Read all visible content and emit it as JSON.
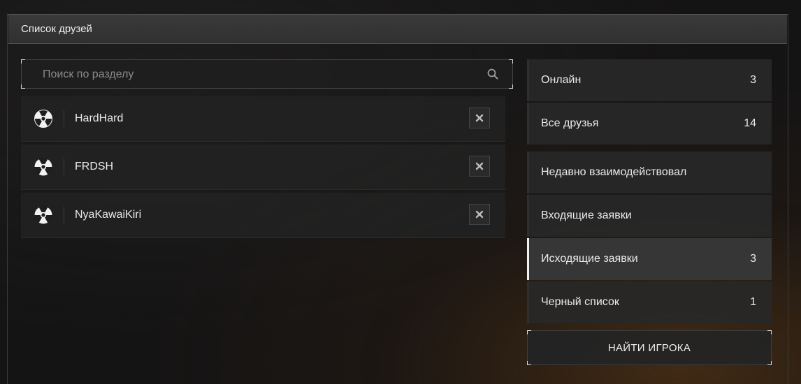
{
  "window": {
    "title": "Список друзей"
  },
  "search": {
    "placeholder": "Поиск по разделу",
    "value": "",
    "icon": "search-icon"
  },
  "friends": [
    {
      "name": "HardHard",
      "avatar_icon": "radiation-icon"
    },
    {
      "name": "FRDSH",
      "avatar_icon": "radiation-icon"
    },
    {
      "name": "NyaKawaiKiri",
      "avatar_icon": "radiation-icon"
    }
  ],
  "categories": [
    {
      "label": "Онлайн",
      "count": "3"
    },
    {
      "label": "Все друзья",
      "count": "14"
    },
    {
      "label": "Недавно взаимодействовал",
      "count": ""
    },
    {
      "label": "Входящие заявки",
      "count": ""
    },
    {
      "label": "Исходящие заявки",
      "count": "3",
      "active": true
    },
    {
      "label": "Черный список",
      "count": "1"
    }
  ],
  "find_button": {
    "label": "НАЙТИ ИГРОКА"
  },
  "colors": {
    "background": "#151414",
    "panel": "#282828",
    "active_accent": "#f2f2f2"
  }
}
